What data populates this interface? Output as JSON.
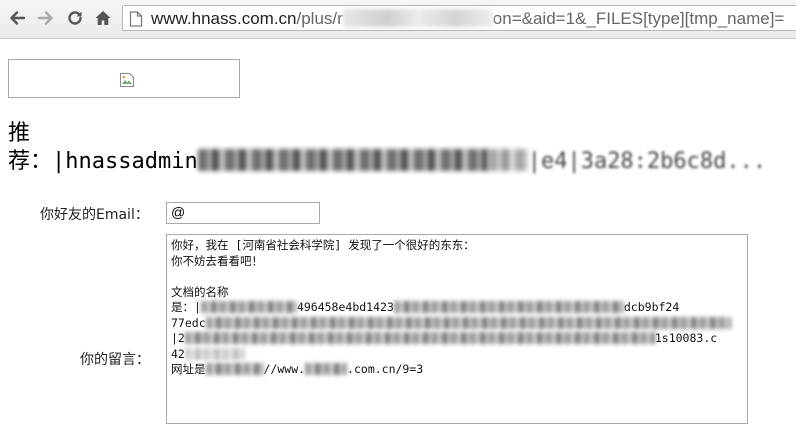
{
  "browser": {
    "url_host": "www.hnass.com.cn",
    "url_path_visible": "/plus/r",
    "url_tail": "on=&aid=1&_FILES[type][tmp_name]="
  },
  "content": {
    "recommend_line1": "推",
    "recommend_prefix": "荐：",
    "recommend_user": "|hnassadmin",
    "recommend_hash_tail": "|e4|3a28:2b6c8d..."
  },
  "form": {
    "email_label": "你好友的Email：",
    "email_value": "@",
    "message_label": "你的留言：",
    "message_lines": [
      "你好，我在 [河南省社会科学院] 发现了一个很好的东东：",
      "你不妨去看看吧！",
      "",
      "文档的名称",
      "是：|",
      "77edc",
      "|2",
      "42",
      "网址是"
    ],
    "message_hash_fragment": "496458e4bd1423",
    "message_hash_fragment2": "dcb9bf24",
    "message_hash_fragment3": "1s10083.c",
    "message_url_tail": "//www.",
    "message_url_domain": ".com.cn/9=3"
  }
}
